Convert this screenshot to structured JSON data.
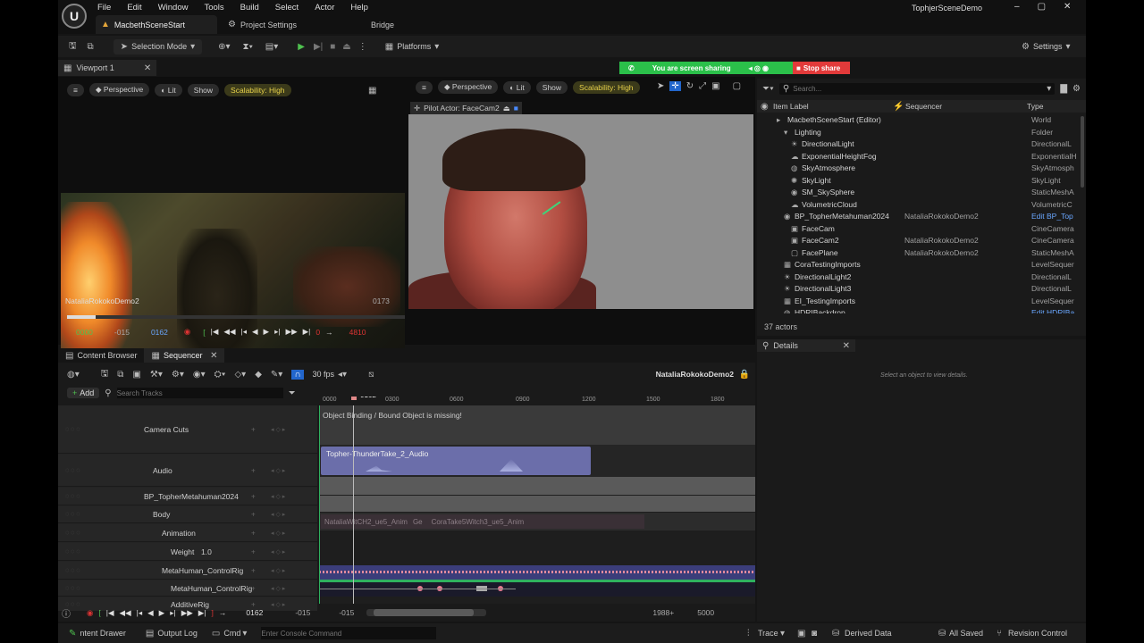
{
  "app": {
    "logo": "U",
    "menu": [
      "File",
      "Edit",
      "Window",
      "Tools",
      "Build",
      "Select",
      "Actor",
      "Help"
    ],
    "tabs": [
      "MacbethSceneStart",
      "Project Settings",
      "Bridge"
    ],
    "project_name": "TophjerSceneDemo",
    "window_controls": [
      "–",
      "▢",
      "✕"
    ]
  },
  "toolbar": {
    "selection_mode": "Selection Mode",
    "platforms": "Platforms",
    "settings": "Settings"
  },
  "screenshare": {
    "message": "You are screen sharing",
    "stop": "Stop share",
    "colors": {
      "bar": "#2bc04a",
      "stop": "#e23a3a"
    }
  },
  "viewport1": {
    "tab": "Viewport 1",
    "perspective": "Perspective",
    "lit": "Lit",
    "show": "Show",
    "scalability": "Scalability: High",
    "sequence_name": "NataliaRokokoDemo2",
    "frame_right": "0173",
    "time_start": "0000",
    "time_neg": "-015",
    "time_current": "0162",
    "time_end_a": "0",
    "time_end_b": "4810"
  },
  "viewport2": {
    "perspective": "Perspective",
    "lit": "Lit",
    "show": "Show",
    "scalability": "Scalability: High",
    "pilot": "Pilot Actor: FaceCam2"
  },
  "outliner": {
    "search_placeholder": "Search...",
    "col_label": "Item Label",
    "col_sequencer": "Sequencer",
    "col_type": "Type",
    "actors_count": "37 actors",
    "items": [
      {
        "label": "MacbethSceneStart (Editor)",
        "seq": "",
        "type": "World",
        "indent": 0,
        "icon": "▸"
      },
      {
        "label": "Lighting",
        "seq": "",
        "type": "Folder",
        "indent": 1,
        "icon": "▾"
      },
      {
        "label": "DirectionalLight",
        "seq": "",
        "type": "DirectionalL",
        "indent": 2,
        "icon": "☀"
      },
      {
        "label": "ExponentialHeightFog",
        "seq": "",
        "type": "ExponentialH",
        "indent": 2,
        "icon": "☁"
      },
      {
        "label": "SkyAtmosphere",
        "seq": "",
        "type": "SkyAtmosph",
        "indent": 2,
        "icon": "◍"
      },
      {
        "label": "SkyLight",
        "seq": "",
        "type": "SkyLight",
        "indent": 2,
        "icon": "✺"
      },
      {
        "label": "SM_SkySphere",
        "seq": "",
        "type": "StaticMeshA",
        "indent": 2,
        "icon": "◉"
      },
      {
        "label": "VolumetricCloud",
        "seq": "",
        "type": "VolumetricC",
        "indent": 2,
        "icon": "☁"
      },
      {
        "label": "BP_TopherMetahuman2024",
        "seq": "NataliaRokokoDemo2",
        "type": "Edit BP_Top",
        "indent": 1,
        "icon": "◉",
        "link": true
      },
      {
        "label": "FaceCam",
        "seq": "",
        "type": "CineCamera",
        "indent": 2,
        "icon": "▣"
      },
      {
        "label": "FaceCam2",
        "seq": "NataliaRokokoDemo2",
        "type": "CineCamera",
        "indent": 2,
        "icon": "▣"
      },
      {
        "label": "FacePlane",
        "seq": "NataliaRokokoDemo2",
        "type": "StaticMeshA",
        "indent": 2,
        "icon": "▢"
      },
      {
        "label": "CoraTestingImports",
        "seq": "",
        "type": "LevelSequer",
        "indent": 1,
        "icon": "▦"
      },
      {
        "label": "DirectionalLight2",
        "seq": "",
        "type": "DirectionalL",
        "indent": 1,
        "icon": "☀"
      },
      {
        "label": "DirectionalLight3",
        "seq": "",
        "type": "DirectionalL",
        "indent": 1,
        "icon": "☀"
      },
      {
        "label": "EI_TestingImports",
        "seq": "",
        "type": "LevelSequer",
        "indent": 1,
        "icon": "▦"
      },
      {
        "label": "HDRIBackdrop",
        "seq": "",
        "type": "Edit HDRIBa",
        "indent": 1,
        "icon": "◍",
        "link": true
      }
    ]
  },
  "details": {
    "title": "Details",
    "hint": "Select an object to view details."
  },
  "sequencer": {
    "tab_content_browser": "Content Browser",
    "tab_sequencer": "Sequencer",
    "fps": "30 fps",
    "sequence_name": "NataliaRokokoDemo2",
    "add": "Add",
    "search_placeholder": "Search Tracks",
    "playhead": "0162",
    "ruler_ticks": [
      "0000",
      "0300",
      "0600",
      "0900",
      "1200",
      "1500",
      "1800"
    ],
    "tracks": [
      {
        "label": "Camera Cuts",
        "indent": 0
      },
      {
        "label": "Audio",
        "indent": 1
      },
      {
        "label": "BP_TopherMetahuman2024",
        "indent": 0
      },
      {
        "label": "Body",
        "indent": 1
      },
      {
        "label": "Animation",
        "indent": 2
      },
      {
        "label": "Weight",
        "indent": 3,
        "value": "1.0"
      },
      {
        "label": "MetaHuman_ControlRig",
        "indent": 2
      },
      {
        "label": "MetaHuman_ControlRig",
        "indent": 3
      },
      {
        "label": "AdditiveRig",
        "indent": 3
      }
    ],
    "binding_warning": "Object Binding / Bound Object is missing!",
    "audio_clip": "Topher-ThunderTake_2_Audio",
    "anim_clip_a": "NataliaWitCH2_ue5_Anim",
    "anim_clip_b": "Ge",
    "anim_clip_c": "CoraTake5Witch3_ue5_Anim",
    "bottom_time": "0162",
    "bottom_neg_a": "-015",
    "bottom_neg_b": "-015",
    "bottom_right_a": "1988+",
    "bottom_right_b": "5000"
  },
  "statusbar": {
    "content_drawer": "ntent Drawer",
    "output_log": "Output Log",
    "cmd": "Cmd",
    "console_placeholder": "Enter Console Command",
    "trace": "Trace",
    "derived_data": "Derived Data",
    "all_saved": "All Saved",
    "revision_control": "Revision Control"
  }
}
